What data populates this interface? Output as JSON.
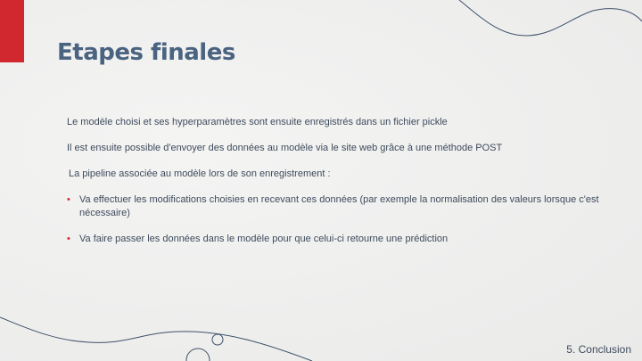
{
  "slide": {
    "title": "Etapes finales",
    "paragraphs": [
      "Le modèle choisi et ses hyperparamètres sont ensuite enregistrés dans un fichier pickle",
      "Il est ensuite possible d'envoyer des données au modèle via le site web grâce à une méthode POST",
      "La pipeline associée au modèle lors de son enregistrement :"
    ],
    "bullets": [
      "Va effectuer les modifications choisies en recevant ces données (par exemple la normalisation des valeurs lorsque c'est nécessaire)",
      "Va faire passer les données dans le modèle pour que celui-ci retourne une prédiction"
    ],
    "footer": "5. Conclusion"
  },
  "colors": {
    "accent": "#d0282e",
    "title": "#4a6380",
    "text": "#3e4b5c",
    "line": "#3f5169"
  }
}
